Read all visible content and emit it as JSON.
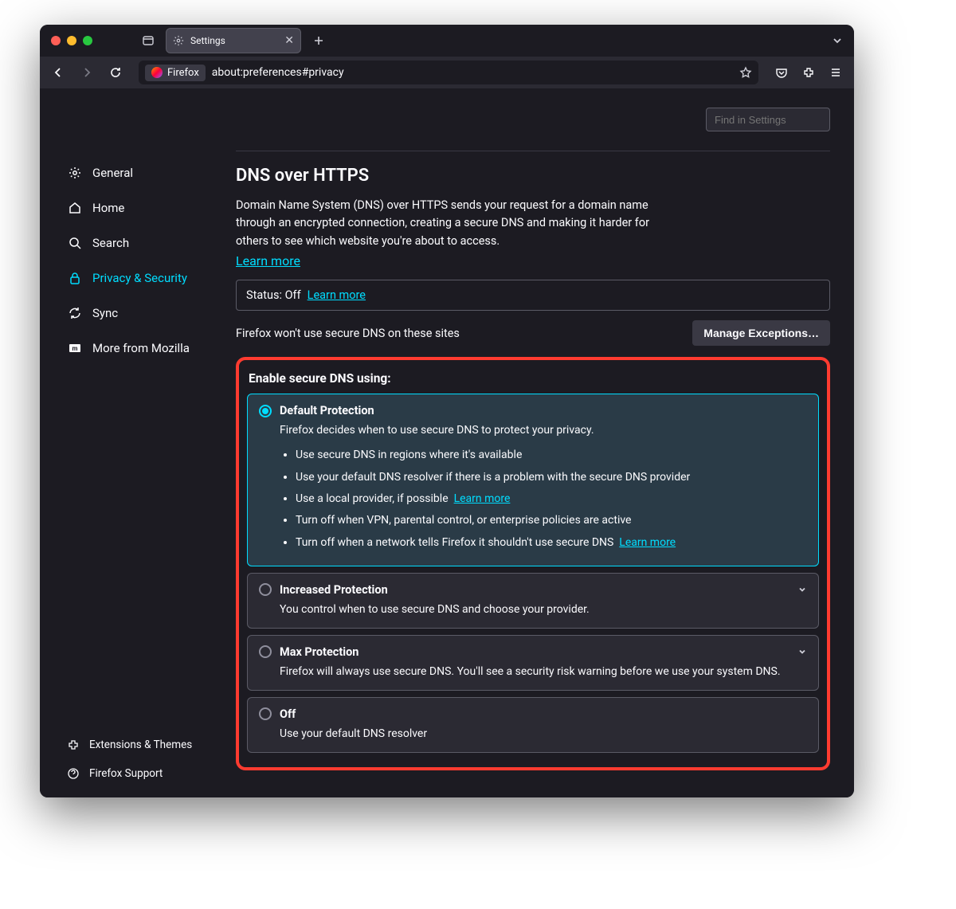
{
  "tab": {
    "title": "Settings"
  },
  "urlbar": {
    "chip": "Firefox",
    "url": "about:preferences#privacy"
  },
  "search": {
    "placeholder": "Find in Settings"
  },
  "sidebar": {
    "items": [
      {
        "label": "General"
      },
      {
        "label": "Home"
      },
      {
        "label": "Search"
      },
      {
        "label": "Privacy & Security"
      },
      {
        "label": "Sync"
      },
      {
        "label": "More from Mozilla"
      }
    ],
    "links": [
      {
        "label": "Extensions & Themes"
      },
      {
        "label": "Firefox Support"
      }
    ]
  },
  "section": {
    "title": "DNS over HTTPS",
    "desc": "Domain Name System (DNS) over HTTPS sends your request for a domain name through an encrypted connection, creating a secure DNS and making it harder for others to see which website you're about to access.",
    "learn_more": "Learn more",
    "status_label": "Status: Off",
    "status_learn_more": "Learn more",
    "exceptions_label": "Firefox won't use secure DNS on these sites",
    "manage_exceptions": "Manage Exceptions…",
    "group_title": "Enable secure DNS using:"
  },
  "options": [
    {
      "title": "Default Protection",
      "desc": "Firefox decides when to use secure DNS to protect your privacy.",
      "selected": true,
      "bullets": [
        {
          "text": "Use secure DNS in regions where it's available"
        },
        {
          "text": "Use your default DNS resolver if there is a problem with the secure DNS provider"
        },
        {
          "text": "Use a local provider, if possible",
          "link": "Learn more"
        },
        {
          "text": "Turn off when VPN, parental control, or enterprise policies are active"
        },
        {
          "text": "Turn off when a network tells Firefox it shouldn't use secure DNS",
          "link": "Learn more"
        }
      ]
    },
    {
      "title": "Increased Protection",
      "desc": "You control when to use secure DNS and choose your provider.",
      "chevron": true
    },
    {
      "title": "Max Protection",
      "desc": "Firefox will always use secure DNS. You'll see a security risk warning before we use your system DNS.",
      "chevron": true
    },
    {
      "title": "Off",
      "desc": "Use your default DNS resolver"
    }
  ]
}
